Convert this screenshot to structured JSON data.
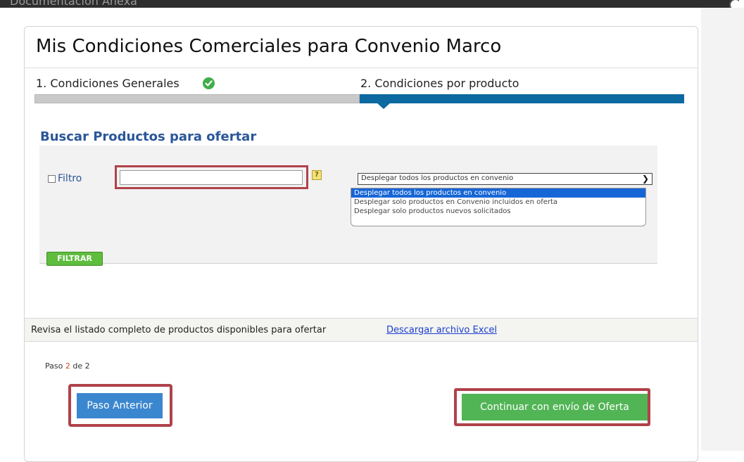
{
  "topbar": {
    "title": "Documentación Anexa"
  },
  "page": {
    "title": "Mis Condiciones Comerciales para Convenio Marco"
  },
  "steps": {
    "step1": "1. Condiciones Generales",
    "step2": "2. Condiciones por producto"
  },
  "search": {
    "title": "Buscar Productos para ofertar",
    "filter_label": "Filtro",
    "filter_value": "",
    "help_icon": "?",
    "select_value": "Desplegar todos los productos en convenio",
    "options": [
      "Desplegar todos los productos en convenio",
      "Desplegar solo productos en Convenio incluidos en oferta",
      "Desplegar solo productos nuevos solicitados"
    ],
    "filter_button": "FILTRAR"
  },
  "info": {
    "text": "Revisa el listado completo de productos disponibles para ofertar",
    "link": "Descargar archivo Excel"
  },
  "footer": {
    "step_prefix": "Paso",
    "step_current": "2",
    "step_mid": "de",
    "step_total": "2",
    "prev_button": "Paso Anterior",
    "next_button": "Continuar con envío de Oferta"
  },
  "colors": {
    "title_blue": "#2a5699",
    "progress_blue": "#0c6aa0",
    "highlight_red": "#b0424a",
    "button_blue": "#3b87cf",
    "button_green": "#51b455"
  }
}
